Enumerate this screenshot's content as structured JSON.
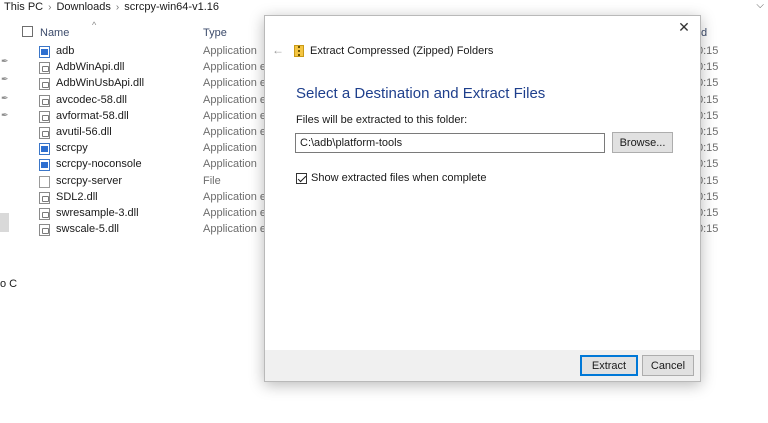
{
  "explorer": {
    "breadcrumb": [
      "This PC",
      "Downloads",
      "scrcpy-win64-v1.16"
    ],
    "columns": {
      "name": "Name",
      "type": "Type",
      "date_partial": "d"
    },
    "left_cut_text": "o C",
    "files": [
      {
        "name": "adb",
        "type": "Application",
        "date": "0:15",
        "icon": "app-icon"
      },
      {
        "name": "AdbWinApi.dll",
        "type": "Application ext",
        "date": "0:15",
        "icon": "dll-icon"
      },
      {
        "name": "AdbWinUsbApi.dll",
        "type": "Application ext",
        "date": "0:15",
        "icon": "dll-icon"
      },
      {
        "name": "avcodec-58.dll",
        "type": "Application ext",
        "date": "0:15",
        "icon": "dll-icon"
      },
      {
        "name": "avformat-58.dll",
        "type": "Application ext",
        "date": "0:15",
        "icon": "dll-icon"
      },
      {
        "name": "avutil-56.dll",
        "type": "Application ext",
        "date": "0:15",
        "icon": "dll-icon"
      },
      {
        "name": "scrcpy",
        "type": "Application",
        "date": "0:15",
        "icon": "app-icon"
      },
      {
        "name": "scrcpy-noconsole",
        "type": "Application",
        "date": "0:15",
        "icon": "app-icon"
      },
      {
        "name": "scrcpy-server",
        "type": "File",
        "date": "0:15",
        "icon": "file-icon"
      },
      {
        "name": "SDL2.dll",
        "type": "Application ext",
        "date": "0:15",
        "icon": "dll-icon"
      },
      {
        "name": "swresample-3.dll",
        "type": "Application ext",
        "date": "0:15",
        "icon": "dll-icon"
      },
      {
        "name": "swscale-5.dll",
        "type": "Application ext",
        "date": "0:15",
        "icon": "dll-icon"
      }
    ]
  },
  "dialog": {
    "window_title": "Extract Compressed (Zipped) Folders",
    "heading": "Select a Destination and Extract Files",
    "label": "Files will be extracted to this folder:",
    "path_value": "C:\\adb\\platform-tools",
    "browse_label": "Browse...",
    "checkbox_label": "Show extracted files when complete",
    "checkbox_checked": true,
    "extract_label": "Extract",
    "cancel_label": "Cancel",
    "close_glyph": "✕",
    "back_glyph": "←"
  },
  "colors": {
    "heading": "#1e3f8c",
    "accent": "#0078d7"
  }
}
